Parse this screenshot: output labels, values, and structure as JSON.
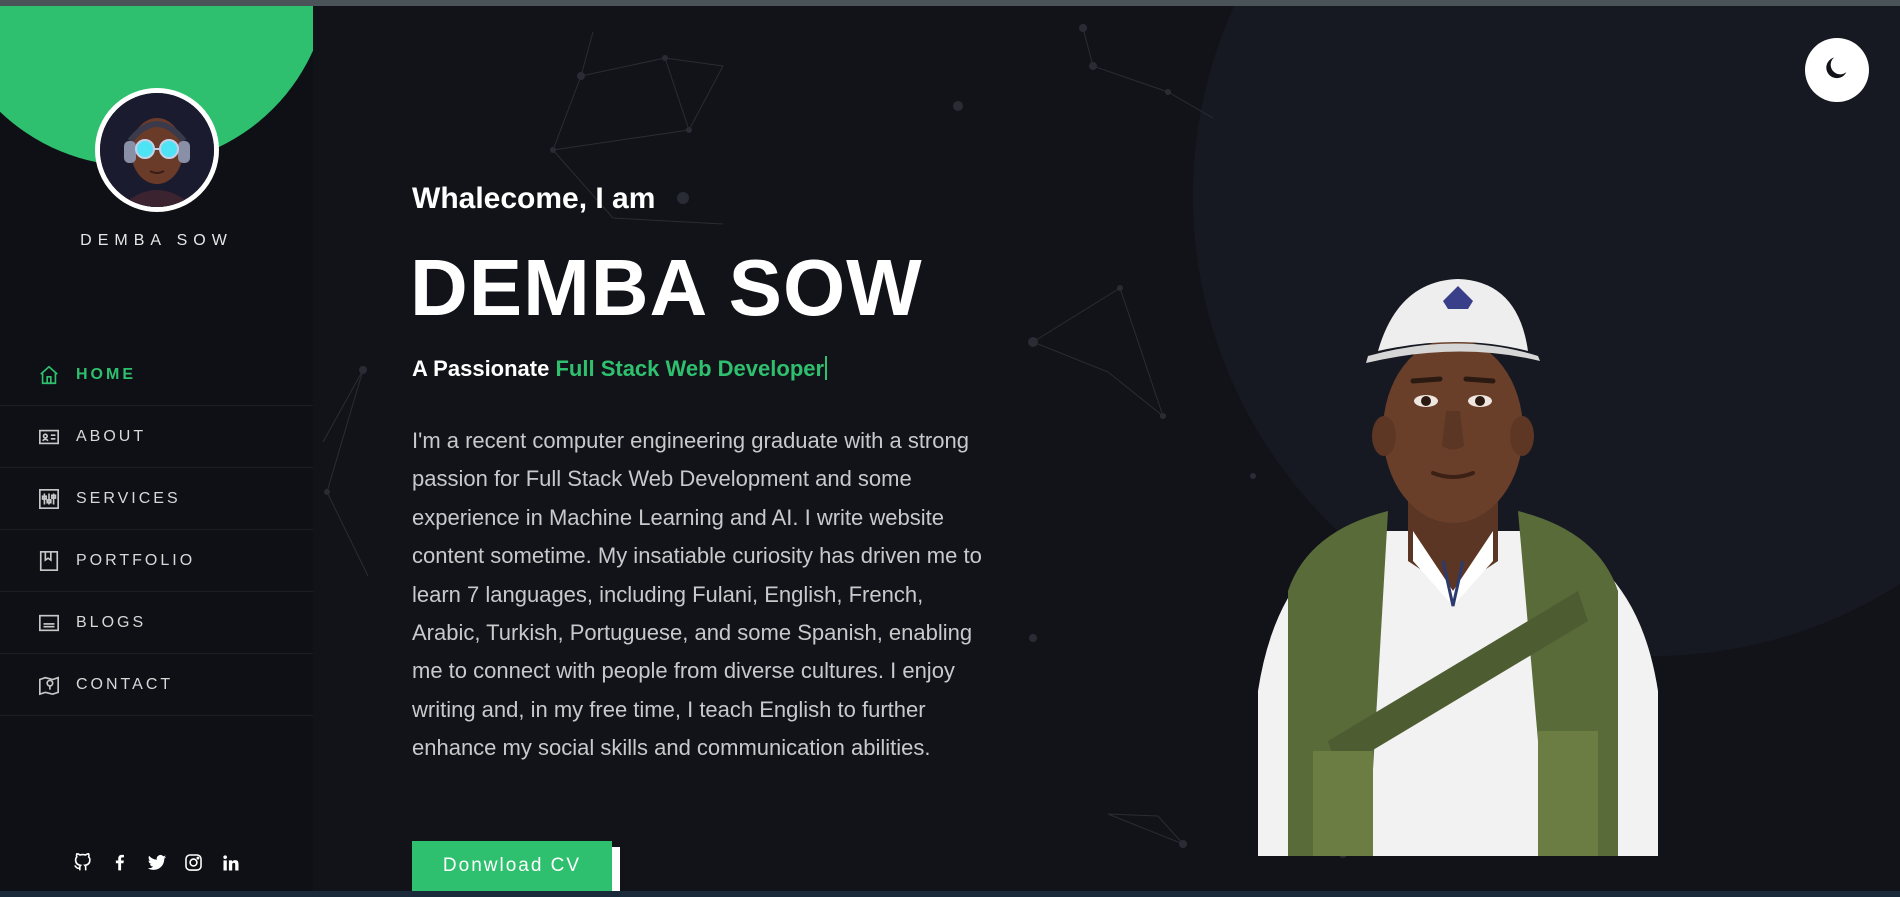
{
  "sidebar": {
    "name": "DEMBA SOW",
    "nav": [
      {
        "label": "HOME",
        "icon": "home-icon",
        "active": true
      },
      {
        "label": "ABOUT",
        "icon": "id-card-icon",
        "active": false
      },
      {
        "label": "SERVICES",
        "icon": "sliders-icon",
        "active": false
      },
      {
        "label": "PORTFOLIO",
        "icon": "bookmark-icon",
        "active": false
      },
      {
        "label": "BLOGS",
        "icon": "list-icon",
        "active": false
      },
      {
        "label": "CONTACT",
        "icon": "map-icon",
        "active": false
      }
    ],
    "socials": [
      "github-icon",
      "facebook-icon",
      "twitter-icon",
      "instagram-icon",
      "linkedin-icon"
    ]
  },
  "hero": {
    "greeting": "Whalecome, I am",
    "name": "DEMBA SOW",
    "tagline_prefix": "A Passionate",
    "tagline_role": "Full Stack Web Developer",
    "about": "I'm a recent computer engineering graduate with a strong passion for Full Stack Web Development and some experience in Machine Learning and AI. I write website content sometime. My insatiable curiosity has driven me to learn 7 languages, including Fulani, English, French, Arabic, Turkish, Portuguese, and some Spanish, enabling me to connect with people from diverse cultures. I enjoy writing and, in my free time, I teach English to further enhance my social skills and communication abilities.",
    "cv_button": "Donwload CV"
  },
  "theme_toggle": {
    "icon": "moon-icon"
  },
  "colors": {
    "accent": "#2ec06e",
    "background": "#121318",
    "sidebar": "#0f1015"
  }
}
